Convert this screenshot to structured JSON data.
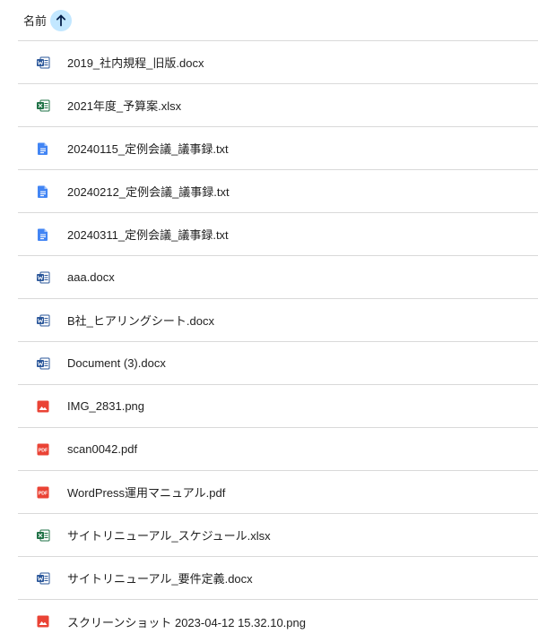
{
  "header": {
    "label": "名前",
    "sort_icon": "arrow-up-icon"
  },
  "files": [
    {
      "name": "2019_社内規程_旧版.docx",
      "type": "word"
    },
    {
      "name": "2021年度_予算案.xlsx",
      "type": "excel"
    },
    {
      "name": "20240115_定例会議_議事録.txt",
      "type": "text"
    },
    {
      "name": "20240212_定例会議_議事録.txt",
      "type": "text"
    },
    {
      "name": "20240311_定例会議_議事録.txt",
      "type": "text"
    },
    {
      "name": "aaa.docx",
      "type": "word"
    },
    {
      "name": "B社_ヒアリングシート.docx",
      "type": "word"
    },
    {
      "name": "Document (3).docx",
      "type": "word"
    },
    {
      "name": "IMG_2831.png",
      "type": "image"
    },
    {
      "name": "scan0042.pdf",
      "type": "pdf"
    },
    {
      "name": "WordPress運用マニュアル.pdf",
      "type": "pdf"
    },
    {
      "name": "サイトリニューアル_スケジュール.xlsx",
      "type": "excel"
    },
    {
      "name": "サイトリニューアル_要件定義.docx",
      "type": "word"
    },
    {
      "name": "スクリーンショット 2023-04-12 15.32.10.png",
      "type": "image"
    }
  ],
  "colors": {
    "word": "#2b579a",
    "excel": "#1e7145",
    "text": "#4285f4",
    "image": "#ea4335",
    "pdf": "#ea4335",
    "sort_bg": "#c2e7ff",
    "divider": "#d9d9d9"
  }
}
